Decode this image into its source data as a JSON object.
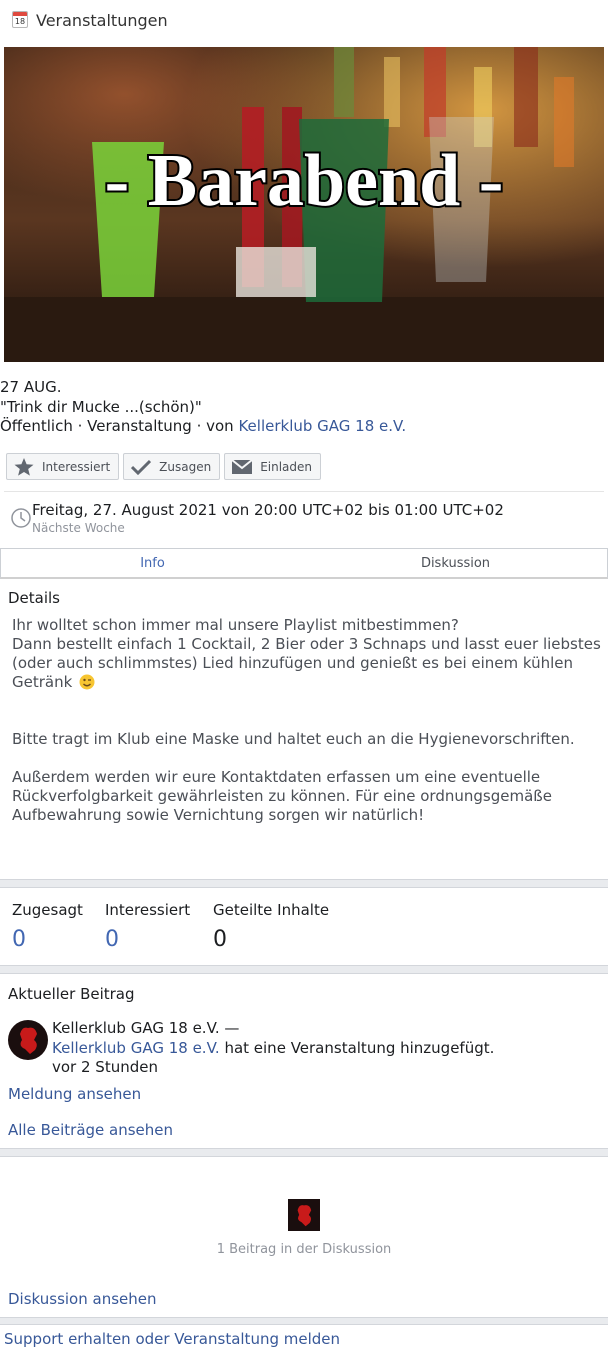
{
  "header": {
    "icon": "calendar-icon",
    "calendar_day": "18",
    "title": "Veranstaltungen"
  },
  "banner": {
    "text": "- Barabend -"
  },
  "event": {
    "date": "27 AUG.",
    "title": "\"Trink dir Mucke ...(schön)\"",
    "meta_prefix": "Öffentlich · Veranstaltung · von ",
    "host": "Kellerklub GAG 18 e.V."
  },
  "actions": {
    "interested": "Interessiert",
    "going": "Zusagen",
    "invite": "Einladen"
  },
  "time": {
    "main": "Freitag, 27. August 2021 von 20:00 UTC+02 bis 01:00 UTC+02",
    "sub": "Nächste Woche"
  },
  "tabs": [
    {
      "label": "Info",
      "active": true
    },
    {
      "label": "Diskussion",
      "active": false
    }
  ],
  "details": {
    "heading": "Details",
    "p1": "Ihr wolltet schon immer mal unsere Playlist mitbestimmen?",
    "p2": "Dann bestellt einfach 1 Cocktail, 2 Bier oder 3 Schnaps und lasst euer liebstes (oder auch schlimmstes) Lied hinzufügen und genießt es bei einem kühlen Getränk",
    "p3": "Bitte tragt im Klub eine Maske und haltet euch an die Hygienevorschriften.",
    "p4": "Außerdem werden wir eure Kontaktdaten erfassen um eine eventuelle Rückverfolgbarkeit gewährleisten zu können. Für eine ordnungsgemäße Aufbewahrung sowie Vernichtung sorgen wir natürlich!"
  },
  "stats": [
    {
      "label": "Zugesagt",
      "value": "0"
    },
    {
      "label": "Interessiert",
      "value": "0"
    },
    {
      "label": "Geteilte Inhalte",
      "value": "0"
    }
  ],
  "recent": {
    "heading": "Aktueller Beitrag",
    "author": "Kellerklub GAG 18 e.V. —",
    "link": "Kellerklub GAG 18 e.V.",
    "action": " hat eine Veranstaltung hinzugefügt.",
    "time": "vor 2 Stunden",
    "view_report": "Meldung ansehen",
    "all_posts": "Alle Beiträge ansehen"
  },
  "discussion": {
    "count": "1 Beitrag in der Diskussion",
    "view": "Diskussion ansehen"
  },
  "footer": {
    "support": "Support erhalten oder Veranstaltung melden"
  },
  "colors": {
    "link": "#385898",
    "tab_active": "#4267b2",
    "band": "#e9ebee"
  }
}
